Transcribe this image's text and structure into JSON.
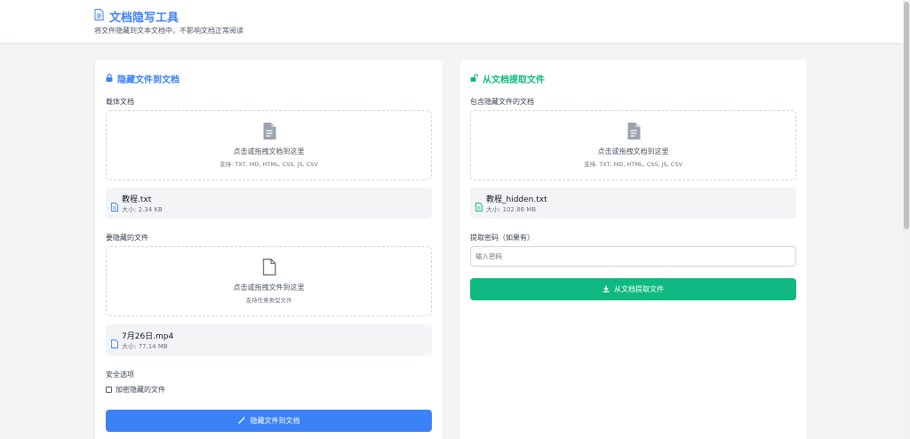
{
  "header": {
    "title": "文档隐写工具",
    "subtitle": "将文件隐藏到文本文档中，不影响文档正常阅读"
  },
  "hide_panel": {
    "title": "隐藏文件到文档",
    "carrier_label": "载体文档",
    "carrier_dropzone": {
      "main": "点击或拖拽文档到这里",
      "sub": "支持: TXT, MD, HTML, CSS, JS, CSV"
    },
    "carrier_file": {
      "name": "教程.txt",
      "size": "大小: 2.34 KB"
    },
    "secret_label": "要隐藏的文件",
    "secret_dropzone": {
      "main": "点击或拖拽文件到这里",
      "sub": "支持任意类型文件"
    },
    "secret_file": {
      "name": "7月26日.mp4",
      "size": "大小: 77.14 MB"
    },
    "security_label": "安全选项",
    "encrypt_label": "加密隐藏的文件",
    "encrypt_checked": false,
    "button_label": "隐藏文件到文档"
  },
  "extract_panel": {
    "title": "从文档提取文件",
    "doc_label": "包含隐藏文件的文档",
    "dropzone": {
      "main": "点击或拖拽文档到这里",
      "sub": "支持: TXT, MD, HTML, CSS, JS, CSV"
    },
    "file": {
      "name": "教程_hidden.txt",
      "size": "大小: 102.86 MB"
    },
    "password_label": "提取密码（如果有）",
    "password_placeholder": "输入密码",
    "button_label": "从文档提取文件"
  },
  "colors": {
    "primary": "#3b82f6",
    "success": "#10b981",
    "background": "#f3f4f6"
  }
}
